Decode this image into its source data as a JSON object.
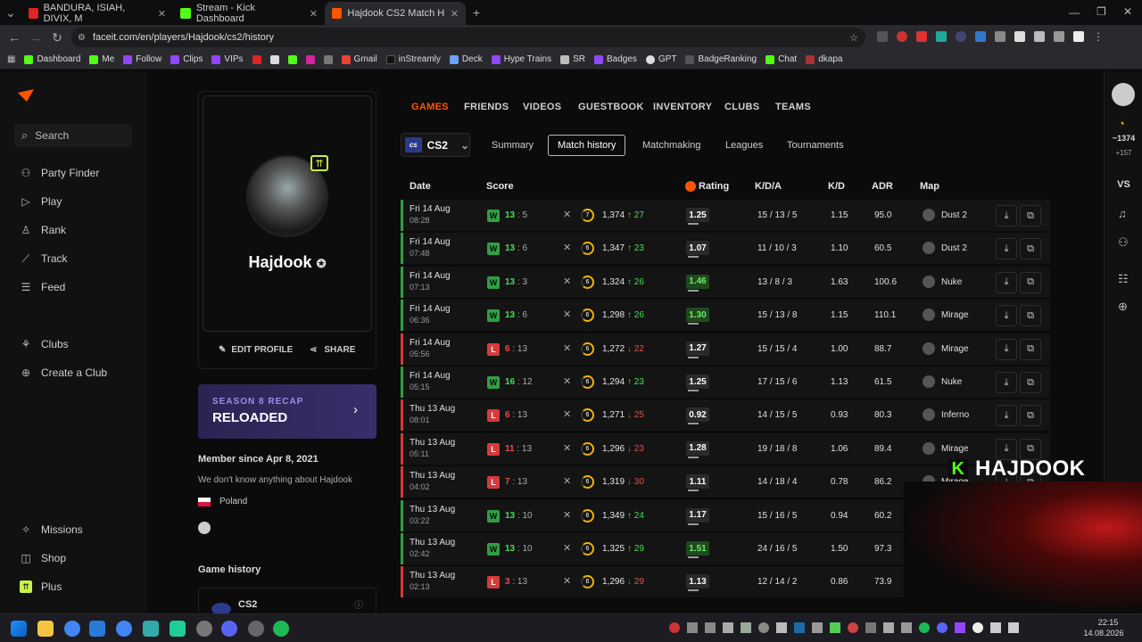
{
  "browser": {
    "tabs": [
      {
        "label": "BANDURA, ISIAH, DIVIX, M",
        "color": "#e02424"
      },
      {
        "label": "Stream - Kick Dashboard",
        "color": "#53fc18"
      },
      {
        "label": "Hajdook CS2 Match History - F",
        "color": "#ff5500"
      }
    ],
    "url": "faceit.com/en/players/Hajdook/cs2/history",
    "bookmarks": [
      "Dashboard",
      "Me",
      "Follow",
      "Clips",
      "VIPs",
      "",
      "",
      "",
      "",
      "",
      "Gmail",
      "inStreamly",
      "Deck",
      "Hype Trains",
      "SR",
      "Badges",
      "GPT",
      "BadgeRanking",
      "Chat",
      "dkapa"
    ]
  },
  "nav": {
    "search": "Search",
    "items": [
      "Party Finder",
      "Play",
      "Rank",
      "Track",
      "Feed"
    ],
    "items2": [
      "Clubs",
      "Create a Club"
    ],
    "bottom": [
      "Missions",
      "Shop",
      "Plus"
    ]
  },
  "profile": {
    "level": "⇈",
    "username": "Hajdook",
    "edit": "EDIT PROFILE",
    "share": "SHARE",
    "recap_small": "SEASON 8 RECAP",
    "recap_big": "RELOADED",
    "member_since": "Member since Apr 8, 2021",
    "bio": "We don't know anything about Hajdook",
    "country": "Poland",
    "game_history": "Game history",
    "game": "CS2"
  },
  "tabs": [
    "GAMES",
    "FRIENDS",
    "VIDEOS",
    "GUESTBOOK",
    "INVENTORY",
    "CLUBS",
    "TEAMS"
  ],
  "game_select": {
    "logo": "cs",
    "label": "CS2"
  },
  "subtabs": [
    "Summary",
    "Match history",
    "Matchmaking",
    "Leagues",
    "Tournaments"
  ],
  "table": {
    "headers": {
      "date": "Date",
      "score": "Score",
      "rating": "Rating",
      "kda": "K/D/A",
      "kd": "K/D",
      "adr": "ADR",
      "map": "Map"
    },
    "rows": [
      {
        "day": "Fri 14 Aug",
        "time": "08:28",
        "res": "W",
        "s1": "13",
        "s2": "5",
        "lvl": "7",
        "elo": "1,374",
        "chg": "↑ 27",
        "up": true,
        "rating": "1.25",
        "hi": false,
        "kda": "15 / 13 / 5",
        "kd": "1.15",
        "adr": "95.0",
        "map": "Dust 2"
      },
      {
        "day": "Fri 14 Aug",
        "time": "07:48",
        "res": "W",
        "s1": "13",
        "s2": "6",
        "lvl": "6",
        "elo": "1,347",
        "chg": "↑ 23",
        "up": true,
        "rating": "1.07",
        "hi": false,
        "kda": "11 / 10 / 3",
        "kd": "1.10",
        "adr": "60.5",
        "map": "Dust 2"
      },
      {
        "day": "Fri 14 Aug",
        "time": "07:13",
        "res": "W",
        "s1": "13",
        "s2": "3",
        "lvl": "6",
        "elo": "1,324",
        "chg": "↑ 26",
        "up": true,
        "rating": "1.46",
        "hi": true,
        "kda": "13 / 8 / 3",
        "kd": "1.63",
        "adr": "100.6",
        "map": "Nuke"
      },
      {
        "day": "Fri 14 Aug",
        "time": "06:36",
        "res": "W",
        "s1": "13",
        "s2": "6",
        "lvl": "6",
        "elo": "1,298",
        "chg": "↑ 26",
        "up": true,
        "rating": "1.30",
        "hi": true,
        "kda": "15 / 13 / 8",
        "kd": "1.15",
        "adr": "110.1",
        "map": "Mirage"
      },
      {
        "day": "Fri 14 Aug",
        "time": "05:56",
        "res": "L",
        "s1": "6",
        "s2": "13",
        "lvl": "6",
        "elo": "1,272",
        "chg": "↓ 22",
        "up": false,
        "rating": "1.27",
        "hi": false,
        "kda": "15 / 15 / 4",
        "kd": "1.00",
        "adr": "88.7",
        "map": "Mirage"
      },
      {
        "day": "Fri 14 Aug",
        "time": "05:15",
        "res": "W",
        "s1": "16",
        "s2": "12",
        "lvl": "6",
        "elo": "1,294",
        "chg": "↑ 23",
        "up": true,
        "rating": "1.25",
        "hi": false,
        "kda": "17 / 15 / 6",
        "kd": "1.13",
        "adr": "61.5",
        "map": "Nuke"
      },
      {
        "day": "Thu 13 Aug",
        "time": "08:01",
        "res": "L",
        "s1": "6",
        "s2": "13",
        "lvl": "6",
        "elo": "1,271",
        "chg": "↓ 25",
        "up": false,
        "rating": "0.92",
        "hi": false,
        "kda": "14 / 15 / 5",
        "kd": "0.93",
        "adr": "80.3",
        "map": "Inferno"
      },
      {
        "day": "Thu 13 Aug",
        "time": "05:11",
        "res": "L",
        "s1": "11",
        "s2": "13",
        "lvl": "6",
        "elo": "1,296",
        "chg": "↓ 23",
        "up": false,
        "rating": "1.28",
        "hi": false,
        "kda": "19 / 18 / 8",
        "kd": "1.06",
        "adr": "89.4",
        "map": "Mirage"
      },
      {
        "day": "Thu 13 Aug",
        "time": "04:02",
        "res": "L",
        "s1": "7",
        "s2": "13",
        "lvl": "6",
        "elo": "1,319",
        "chg": "↓ 30",
        "up": false,
        "rating": "1.11",
        "hi": false,
        "kda": "14 / 18 / 4",
        "kd": "0.78",
        "adr": "86.2",
        "map": "Mirage"
      },
      {
        "day": "Thu 13 Aug",
        "time": "03:22",
        "res": "W",
        "s1": "13",
        "s2": "10",
        "lvl": "6",
        "elo": "1,349",
        "chg": "↑ 24",
        "up": true,
        "rating": "1.17",
        "hi": false,
        "kda": "15 / 16 / 5",
        "kd": "0.94",
        "adr": "60.2",
        "map": ""
      },
      {
        "day": "Thu 13 Aug",
        "time": "02:42",
        "res": "W",
        "s1": "13",
        "s2": "10",
        "lvl": "6",
        "elo": "1,325",
        "chg": "↑ 29",
        "up": true,
        "rating": "1.51",
        "hi": true,
        "kda": "24 / 16 / 5",
        "kd": "1.50",
        "adr": "97.3",
        "map": ""
      },
      {
        "day": "Thu 13 Aug",
        "time": "02:13",
        "res": "L",
        "s1": "3",
        "s2": "13",
        "lvl": "6",
        "elo": "1,296",
        "chg": "↓ 29",
        "up": false,
        "rating": "1.13",
        "hi": false,
        "kda": "12 / 14 / 2",
        "kd": "0.86",
        "adr": "73.9",
        "map": ""
      }
    ]
  },
  "right_rail": {
    "points": "~1374",
    "delta": "+157",
    "vs": "VS"
  },
  "overlay": {
    "streamer": "HAJDOOK",
    "k": "K"
  },
  "taskbar": {
    "time": "22:15",
    "date": "14.08.2026"
  }
}
